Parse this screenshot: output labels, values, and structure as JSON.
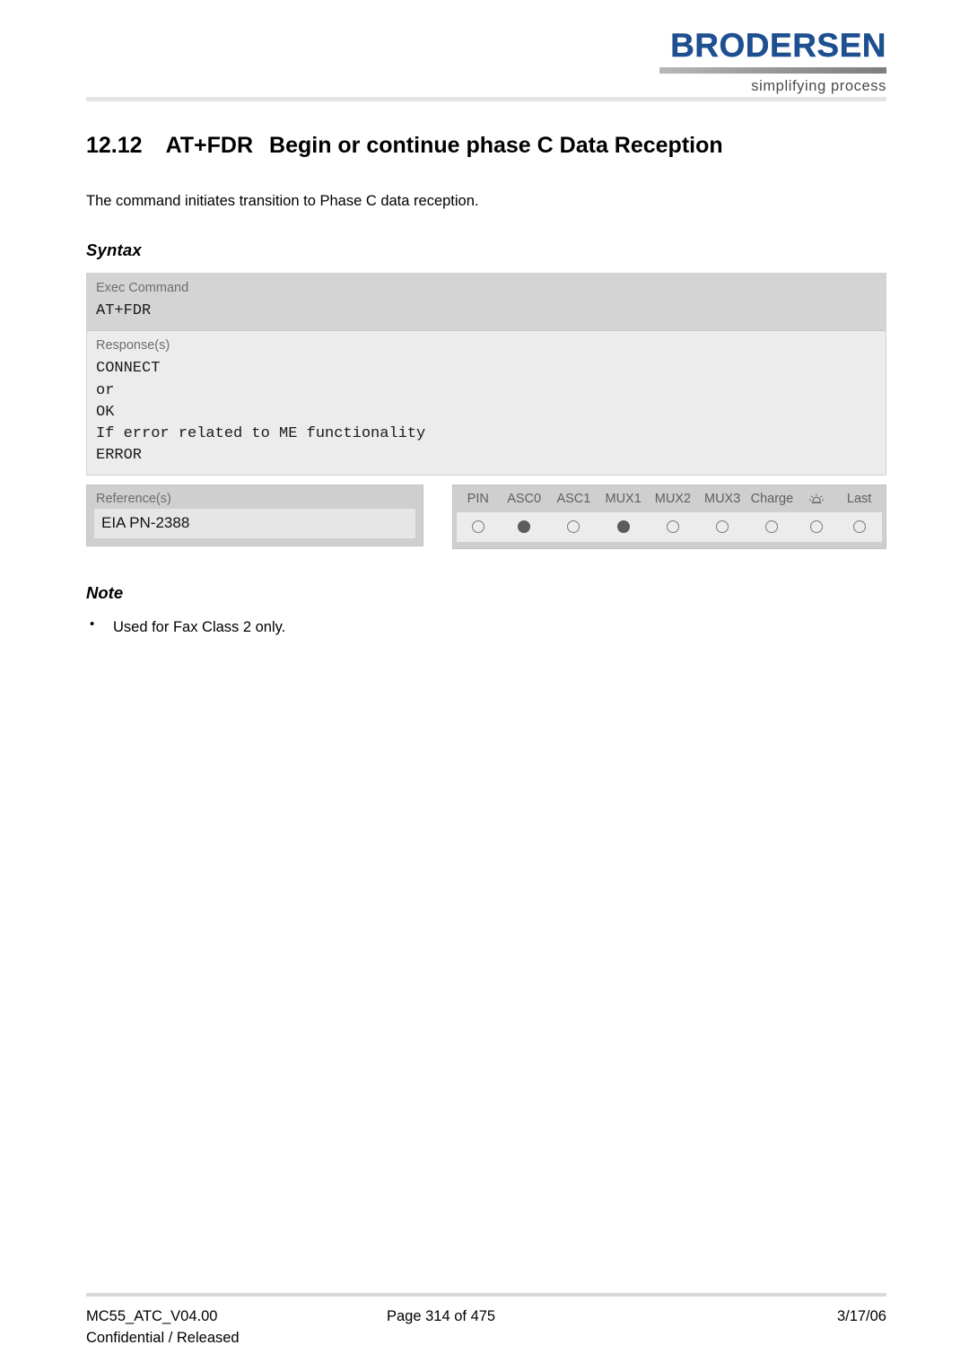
{
  "header": {
    "logo_wordmark": "BRODERSEN",
    "logo_tagline": "simplifying process"
  },
  "document": {
    "section_number": "12.12",
    "command_name": "AT+FDR",
    "section_title": "Begin or continue phase C Data Reception",
    "intro": "The command initiates transition to Phase C data reception."
  },
  "syntax": {
    "heading": "Syntax",
    "exec": {
      "label": "Exec Command",
      "code": "AT+FDR"
    },
    "response": {
      "label": "Response(s)",
      "code": "CONNECT\nor\nOK\nIf error related to ME functionality\nERROR"
    }
  },
  "reference": {
    "label": "Reference(s)",
    "value": "EIA PN-2388"
  },
  "indicators": {
    "columns": [
      {
        "label": "PIN",
        "icon": "",
        "state": "empty"
      },
      {
        "label": "ASC0",
        "icon": "",
        "state": "filled"
      },
      {
        "label": "ASC1",
        "icon": "",
        "state": "empty"
      },
      {
        "label": "MUX1",
        "icon": "",
        "state": "filled"
      },
      {
        "label": "MUX2",
        "icon": "",
        "state": "empty"
      },
      {
        "label": "MUX3",
        "icon": "",
        "state": "empty"
      },
      {
        "label": "Charge",
        "icon": "",
        "state": "empty"
      },
      {
        "label": "",
        "icon": "alarm-bell-icon",
        "state": "empty"
      },
      {
        "label": "Last",
        "icon": "",
        "state": "empty"
      }
    ]
  },
  "note": {
    "heading": "Note",
    "items": [
      "Used for Fax Class 2 only."
    ]
  },
  "footer": {
    "doc_id": "MC55_ATC_V04.00",
    "classification": "Confidential / Released",
    "page": "Page 314 of 475",
    "date": "3/17/06"
  },
  "colors": {
    "brand_blue": "#1d4f91",
    "panel_dark": "#d4d4d4",
    "panel_light": "#ececec",
    "label_gray": "#6d6d6d",
    "dot_filled": "#5c5c5c"
  }
}
